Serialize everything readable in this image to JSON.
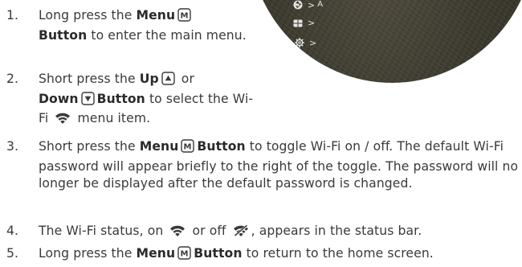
{
  "device_screen": {
    "menu_items": [
      {
        "icon": "aperture-icon",
        "chevron": ">",
        "value": "A"
      },
      {
        "icon": "grid-icon",
        "chevron": ">",
        "value": ""
      },
      {
        "icon": "settings-gear-icon",
        "chevron": ">",
        "value": ""
      }
    ]
  },
  "steps": [
    {
      "number": "1.",
      "parts": [
        "Long press the ",
        "Menu",
        " ",
        "Button",
        " to enter the main menu."
      ]
    },
    {
      "number": "2.",
      "parts": [
        "Short press the ",
        "Up",
        " ",
        " or ",
        "Down",
        " ",
        "Button",
        " to select the Wi-Fi ",
        " menu item."
      ]
    },
    {
      "number": "3.",
      "parts": [
        "Short press the ",
        "Menu",
        " ",
        "Button",
        " to toggle Wi-Fi on / off. The default Wi-Fi password will appear briefly to the right of the toggle. The password will no longer be displayed after the default password is changed."
      ]
    },
    {
      "number": "4.",
      "parts": [
        "The Wi-Fi status, on ",
        " or off ",
        ", appears in the status bar."
      ]
    },
    {
      "number": "5.",
      "parts": [
        "Long press the ",
        "Menu",
        " ",
        "Button",
        " to return to the home screen."
      ]
    }
  ],
  "icons": {
    "menu_button": "M-button-icon",
    "up_button": "up-arrow-button-icon",
    "down_button": "down-arrow-button-icon",
    "wifi_on": "wifi-icon",
    "wifi_off": "wifi-off-icon"
  }
}
